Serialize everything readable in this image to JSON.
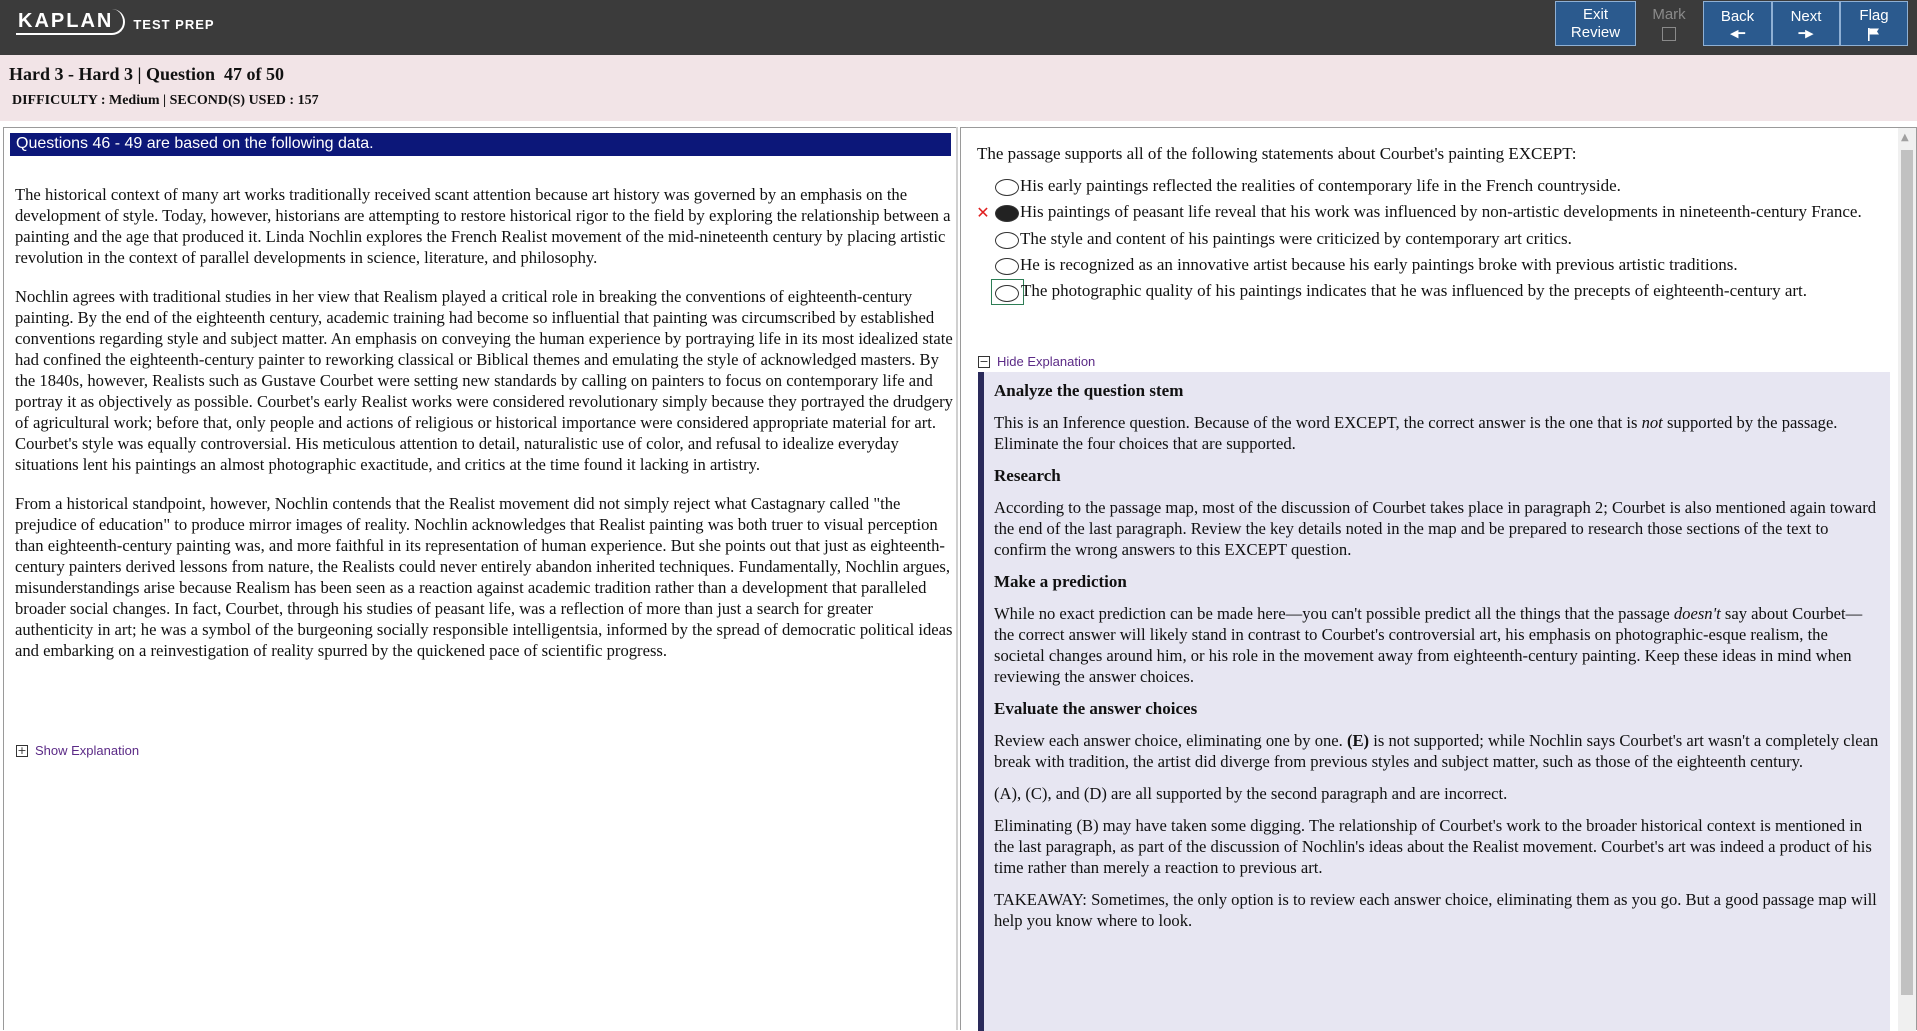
{
  "header": {
    "logo_text": "KAPLAN",
    "logo_sub": "TEST PREP",
    "buttons": {
      "exit_line1": "Exit",
      "exit_line2": "Review",
      "mark": "Mark",
      "back": "Back",
      "next": "Next",
      "flag": "Flag"
    },
    "brand_color": "#2b5a8e"
  },
  "info": {
    "title": "Hard 3 - Hard 3 | Question  47 of 50",
    "meta": "DIFFICULTY : Medium | SECOND(S) USED : 157"
  },
  "passage": {
    "header": "Questions 46 - 49 are based on the following data.",
    "paragraphs": [
      "The historical context of many art works traditionally received scant attention because art history was governed by an emphasis on the development of style. Today, however, historians are attempting to restore historical rigor to the field by exploring the relationship between a painting and the age that produced it. Linda Nochlin explores the French Realist movement of the mid-nineteenth century by placing artistic revolution in the context of parallel developments in science, literature, and philosophy.",
      "Nochlin agrees with traditional studies in her view that Realism played a critical role in breaking the conventions of eighteenth-century painting. By the end of the eighteenth century, academic training had become so influential that painting was circumscribed by established conventions regarding style and subject matter. An emphasis on conveying the human experience by portraying life in its most idealized state had confined the eighteenth-century painter to reworking classical or Biblical themes and emulating the style of acknowledged masters. By the 1840s, however, Realists such as Gustave Courbet were setting new standards by calling on painters to focus on contemporary life and portray it as objectively as possible. Courbet's early Realist works were considered revolutionary simply because they portrayed the drudgery of agricultural work; before that, only people and actions of religious or historical importance were considered appropriate material for art. Courbet's style was equally controversial. His meticulous attention to detail, naturalistic use of color, and refusal to idealize everyday situations lent his paintings an almost photographic exactitude, and critics at the time found it lacking in artistry.",
      "From a historical standpoint, however, Nochlin contends that the Realist movement did not simply reject what Castagnary called \"the prejudice of education\" to produce mirror images of reality. Nochlin acknowledges that Realist painting was both truer to visual perception than eighteenth-century painting was, and more faithful in its representation of human experience. But she points out that just as eighteenth-century painters derived lessons from nature, the Realists could never entirely abandon inherited techniques. Fundamentally, Nochlin argues, misunderstandings arise because Realism has been seen as a reaction against academic tradition rather than a development that paralleled broader social changes. In fact, Courbet, through his studies of peasant life, was a reflection of more than just a search for greater authenticity in art; he was a symbol of the burgeoning socially responsible intelligentsia, informed by the spread of democratic political ideas and embarking on a reinvestigation of reality spurred by the quickened pace of scientific progress."
    ],
    "show_explanation": "Show Explanation"
  },
  "question": {
    "stem": "The passage supports all of the following statements about Courbet's painting EXCEPT:",
    "choices": [
      {
        "text": "His early paintings reflected the realities of contemporary life in the French countryside.",
        "mark": ""
      },
      {
        "text": "His paintings of peasant life reveal that his work was influenced by non-artistic developments in nineteenth-century France.",
        "mark": "✕"
      },
      {
        "text": "The style and content of his paintings were criticized by contemporary art critics.",
        "mark": ""
      },
      {
        "text": "He is recognized as an innovative artist because his early paintings broke with previous artistic traditions.",
        "mark": ""
      },
      {
        "text": "The photographic quality of his paintings indicates that he was influenced by the precepts of eighteenth-century art.",
        "mark": ""
      }
    ],
    "selected_index": 1,
    "correct_index": 4,
    "hide_explanation": "Hide Explanation"
  },
  "explanation": {
    "h1": "Analyze the question stem",
    "p1_a": "This is an Inference question. Because of the word EXCEPT, the correct answer is the one that is ",
    "p1_em": "not",
    "p1_b": " supported by the passage. Eliminate the four choices that are supported.",
    "h2": "Research",
    "p2": "According to the passage map, most of the discussion of Courbet takes place in paragraph 2; Courbet is also mentioned again toward the end of the last paragraph. Review the key details noted in the map and be prepared to research those sections of the text to confirm the wrong answers to this EXCEPT question.",
    "h3": "Make a prediction",
    "p3_a": "While no exact prediction can be made here—you can't possible predict all the things that the passage ",
    "p3_em": "doesn't",
    "p3_b": " say about Courbet—the correct answer will likely stand in contrast to Courbet's controversial art, his emphasis on photographic-esque realism, the societal changes around him, or his role in the movement away from eighteenth-century painting. Keep these ideas in mind when reviewing the answer choices.",
    "h4": "Evaluate the answer choices",
    "p4_a": "Review each answer choice, eliminating one by one. ",
    "p4_b": "(E)",
    "p4_c": " is not supported; while Nochlin says Courbet's art wasn't a completely clean break with tradition, the artist did diverge from previous styles and subject matter, such as those of the eighteenth century.",
    "p5": "(A), (C), and (D) are all supported by the second paragraph and are incorrect.",
    "p6": "Eliminating (B) may have taken some digging. The relationship of Courbet's work to the broader historical context is mentioned in the last paragraph, as part of the discussion of Nochlin's ideas about the Realist movement. Courbet's art was indeed a product of his time rather than merely a reaction to previous art.",
    "p7": "TAKEAWAY: Sometimes, the only option is to review each answer choice, eliminating them as you go. But a good passage map will help you know where to look."
  },
  "icons": {
    "flag": "flag-icon",
    "back_arrow": "arrow-left-icon",
    "next_arrow": "arrow-right-icon",
    "incorrect": "x-mark-icon",
    "expand": "plus-box-icon",
    "collapse": "minus-box-icon"
  }
}
